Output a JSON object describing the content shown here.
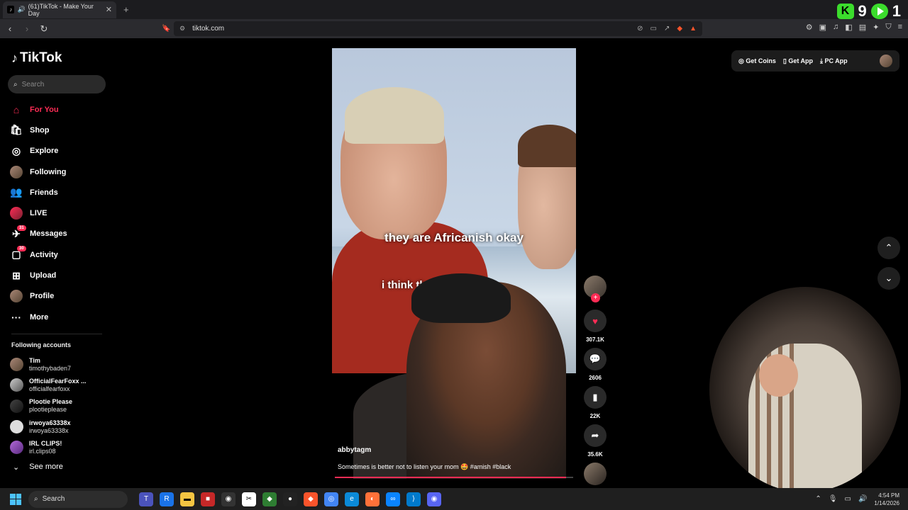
{
  "browser": {
    "tab_title": "(61)TikTok - Make Your Day",
    "url": "tiktok.com",
    "ext_count": "9",
    "ext_count2": "1"
  },
  "tiktok": {
    "logo": "TikTok",
    "search_placeholder": "Search",
    "nav": [
      {
        "label": "For You",
        "icon": "home-icon",
        "badge": ""
      },
      {
        "label": "Shop",
        "icon": "shop-icon",
        "badge": ""
      },
      {
        "label": "Explore",
        "icon": "compass-icon",
        "badge": ""
      },
      {
        "label": "Following",
        "icon": "following-avatar-icon",
        "badge": ""
      },
      {
        "label": "Friends",
        "icon": "friends-icon",
        "badge": ""
      },
      {
        "label": "LIVE",
        "icon": "live-icon",
        "badge": ""
      },
      {
        "label": "Messages",
        "icon": "messages-icon",
        "badge": "31"
      },
      {
        "label": "Activity",
        "icon": "activity-icon",
        "badge": "30"
      },
      {
        "label": "Upload",
        "icon": "upload-icon",
        "badge": ""
      },
      {
        "label": "Profile",
        "icon": "profile-avatar-icon",
        "badge": ""
      },
      {
        "label": "More",
        "icon": "more-icon",
        "badge": ""
      }
    ],
    "following_title": "Following accounts",
    "following": [
      {
        "name": "Tim",
        "handle": "timothybaden7"
      },
      {
        "name": "OfficialFearFoxx ...",
        "handle": "officialfearfoxx"
      },
      {
        "name": "Plootie Please",
        "handle": "plootieplease"
      },
      {
        "name": "irwoya63338x",
        "handle": "irwoya63338x"
      },
      {
        "name": "IRL CLIPS!",
        "handle": "irl.clips08"
      }
    ],
    "see_more": "See more",
    "top": {
      "get_coins": "Get Coins",
      "get_app": "Get App",
      "pc_app": "PC App"
    }
  },
  "video": {
    "caption1": "they are Africanish okay",
    "caption2": "i think th           esome",
    "user": "abbytagm",
    "desc": "Sometimes is better not to listen your mom 🤩 #amish #black",
    "progress": 0.97,
    "likes": "307.1K",
    "comments": "2606",
    "saves": "22K",
    "shares": "35.6K"
  },
  "taskbar": {
    "search": "Search",
    "time": "4:54 PM",
    "date": "1/14/2026"
  },
  "colors": {
    "accent": "#fe2c55",
    "bg": "#000000",
    "green": "#3bdc2c"
  }
}
